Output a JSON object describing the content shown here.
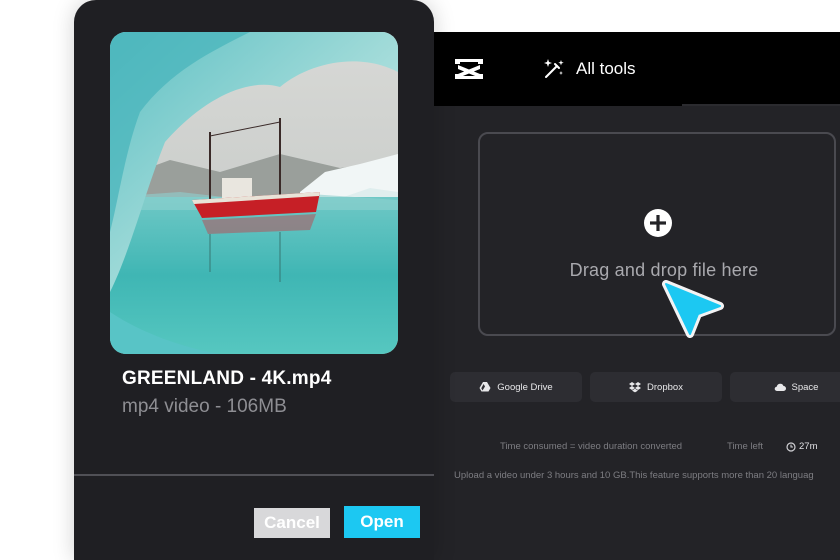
{
  "app": {
    "logo_icon": "capcut-logo-icon",
    "nav": {
      "all_tools_label": "All tools",
      "all_tools_icon": "magic-wand-icon"
    },
    "upload": {
      "plus_icon": "plus-circle-icon",
      "drop_text": "Drag and drop file here",
      "cursor_icon": "cursor-pointer-icon",
      "cursor_color": "#1cc8f2"
    },
    "sources": [
      {
        "label": "Google Drive",
        "icon": "google-drive-icon"
      },
      {
        "label": "Dropbox",
        "icon": "dropbox-icon"
      },
      {
        "label": "Space",
        "icon": "cloud-icon"
      }
    ],
    "info": {
      "time_consumed": "Time consumed = video duration converted",
      "time_left_label": "Time left",
      "time_left_value": "27m",
      "clock_icon": "clock-icon",
      "upload_note": "Upload a video under 3 hours and 10 GB.This feature supports more than 20 languag"
    }
  },
  "dialog": {
    "thumbnail_icon": "video-thumbnail-boat-iceberg",
    "file_name": "GREENLAND - 4K.mp4",
    "file_meta": "mp4 video - 106MB",
    "cancel_label": "Cancel",
    "open_label": "Open",
    "accent_color": "#1cc8f2"
  }
}
